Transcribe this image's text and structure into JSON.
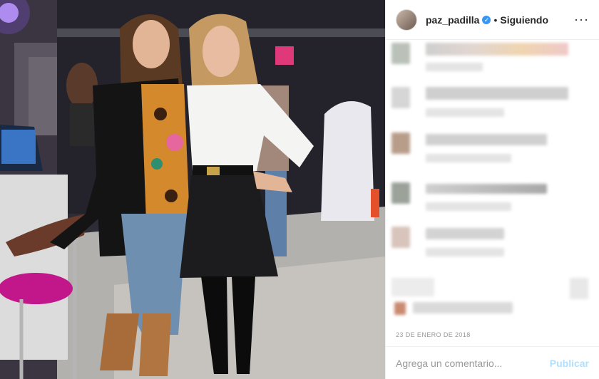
{
  "post": {
    "username": "paz_padilla",
    "verified_badge": "✓",
    "separator": "•",
    "follow_state": "Siguiendo",
    "more_icon": "···",
    "date": "23 DE ENERO DE 2018"
  },
  "comment_box": {
    "placeholder": "Agrega un comentario...",
    "publish": "Publicar"
  },
  "photo": {
    "alt": "Dos mujeres posando en un plató de televisión"
  }
}
